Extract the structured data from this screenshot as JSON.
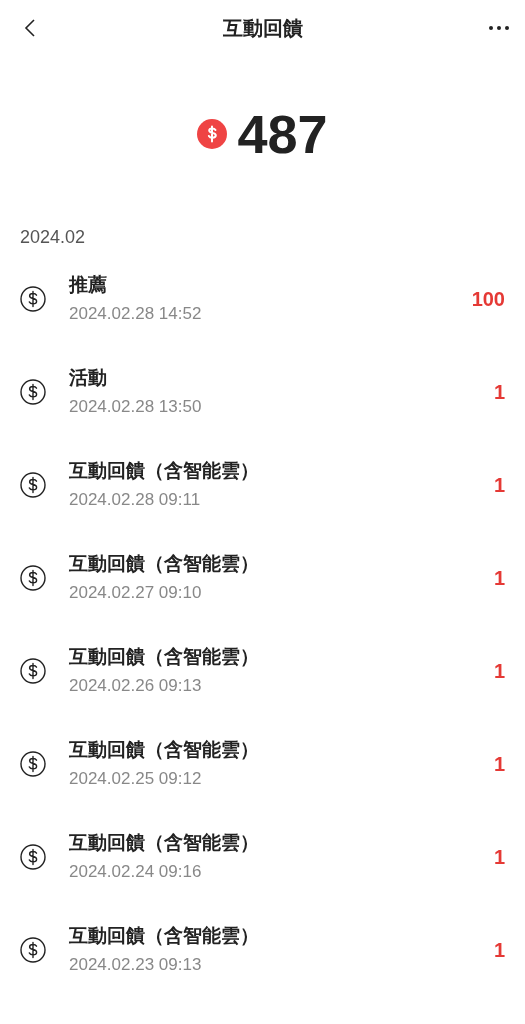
{
  "header": {
    "title": "互動回饋"
  },
  "balance": {
    "amount": "487"
  },
  "month": "2024.02",
  "records": [
    {
      "title": "推薦",
      "time": "2024.02.28 14:52",
      "amount": "100"
    },
    {
      "title": "活動",
      "time": "2024.02.28 13:50",
      "amount": "1"
    },
    {
      "title": "互動回饋（含智能雲）",
      "time": "2024.02.28 09:11",
      "amount": "1"
    },
    {
      "title": "互動回饋（含智能雲）",
      "time": "2024.02.27 09:10",
      "amount": "1"
    },
    {
      "title": "互動回饋（含智能雲）",
      "time": "2024.02.26 09:13",
      "amount": "1"
    },
    {
      "title": "互動回饋（含智能雲）",
      "time": "2024.02.25 09:12",
      "amount": "1"
    },
    {
      "title": "互動回饋（含智能雲）",
      "time": "2024.02.24 09:16",
      "amount": "1"
    },
    {
      "title": "互動回饋（含智能雲）",
      "time": "2024.02.23 09:13",
      "amount": "1"
    }
  ]
}
